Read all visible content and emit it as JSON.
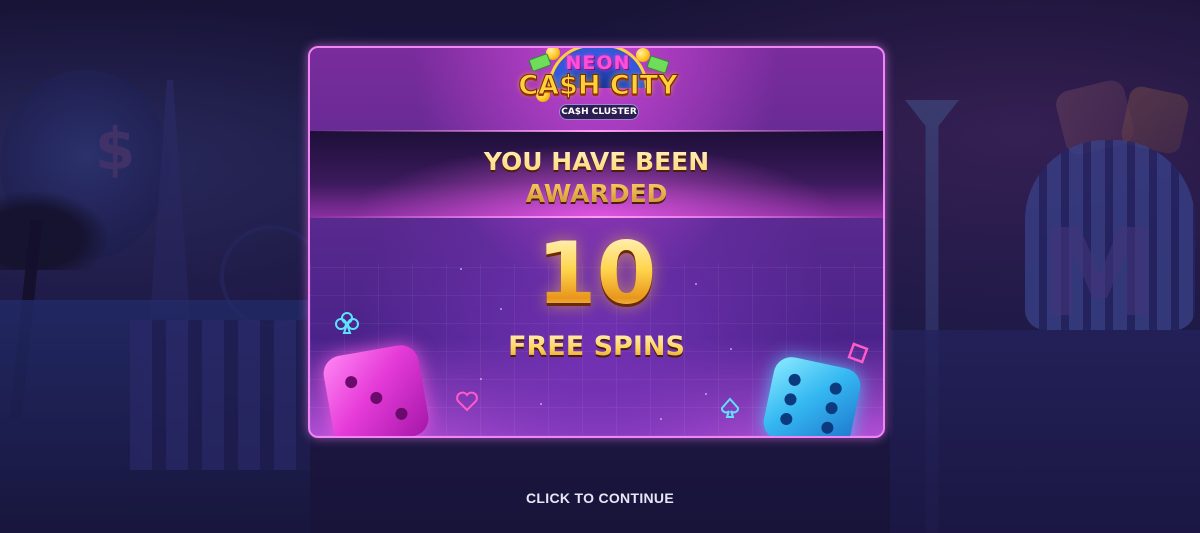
{
  "game": {
    "logo": {
      "line1": "NEON",
      "line2": "CA$H CITY",
      "tagline": "CA$H CLUSTER"
    },
    "award": {
      "line1": "YOU HAVE BEEN",
      "line2": "AWARDED",
      "count": "10",
      "label": "FREE SPINS"
    },
    "continue_label": "CLICK TO CONTINUE"
  },
  "colors": {
    "modal_border": "#f085f5",
    "gold_text": "#ffd35e",
    "background": "#1e1a48"
  },
  "icons": [
    "club-icon",
    "heart-icon",
    "spade-icon",
    "diamond-icon",
    "dice-icon"
  ]
}
